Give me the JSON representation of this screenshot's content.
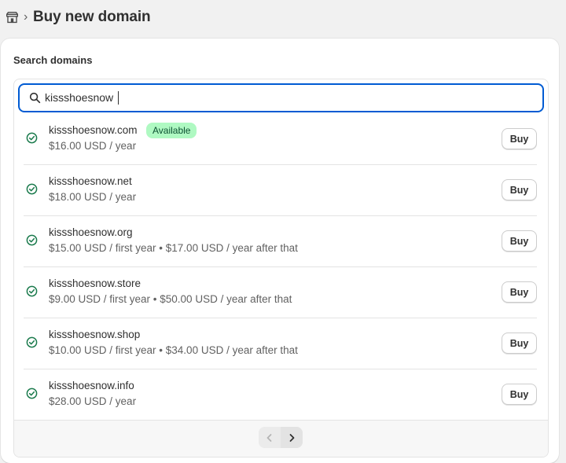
{
  "header": {
    "icon": "store-icon",
    "title": "Buy new domain"
  },
  "search_section": {
    "title": "Search domains",
    "query": "kissshoesnow",
    "accent_color": "#005bd3"
  },
  "results": [
    {
      "name": "kissshoesnow.com",
      "price": "$16.00 USD / year",
      "badge": "Available",
      "button": "Buy"
    },
    {
      "name": "kissshoesnow.net",
      "price": "$18.00 USD / year",
      "button": "Buy"
    },
    {
      "name": "kissshoesnow.org",
      "price": "$15.00 USD / first year • $17.00 USD / year after that",
      "button": "Buy"
    },
    {
      "name": "kissshoesnow.store",
      "price": "$9.00 USD / first year • $50.00 USD / year after that",
      "button": "Buy"
    },
    {
      "name": "kissshoesnow.shop",
      "price": "$10.00 USD / first year • $34.00 USD / year after that",
      "button": "Buy"
    },
    {
      "name": "kissshoesnow.info",
      "price": "$28.00 USD / year",
      "button": "Buy"
    }
  ],
  "colors": {
    "available_badge_bg": "#aff9c2",
    "available_badge_text": "#0c5132",
    "check_icon": "#1a7a4c"
  },
  "pagination": {
    "prev_icon": "chevron-left-icon",
    "next_icon": "chevron-right-icon",
    "prev_enabled": false,
    "next_enabled": true
  }
}
